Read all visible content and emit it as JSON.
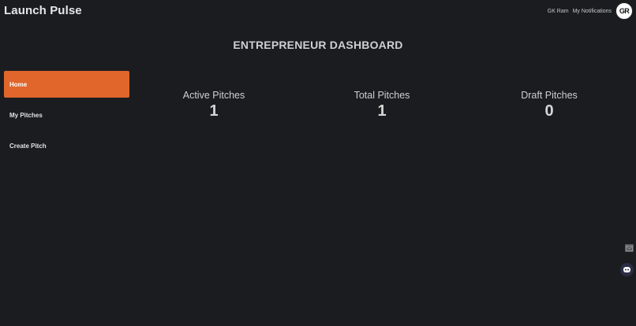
{
  "app": {
    "title": "Launch Pulse"
  },
  "header": {
    "user_name": "GK Ram",
    "notifications_label": "My Notifications",
    "avatar_initials": "GR"
  },
  "page": {
    "title": "ENTREPRENEUR DASHBOARD"
  },
  "sidebar": {
    "items": [
      {
        "label": "Home",
        "active": true
      },
      {
        "label": "My Pitches",
        "active": false
      },
      {
        "label": "Create Pitch",
        "active": false
      }
    ]
  },
  "stats": [
    {
      "label": "Active Pitches",
      "value": "1"
    },
    {
      "label": "Total Pitches",
      "value": "1"
    },
    {
      "label": "Draft Pitches",
      "value": "0"
    }
  ],
  "colors": {
    "background": "#1b1c20",
    "accent": "#e0662c"
  },
  "icons": {
    "right_edge": [
      "mail-icon",
      "chat-bot-icon"
    ]
  }
}
